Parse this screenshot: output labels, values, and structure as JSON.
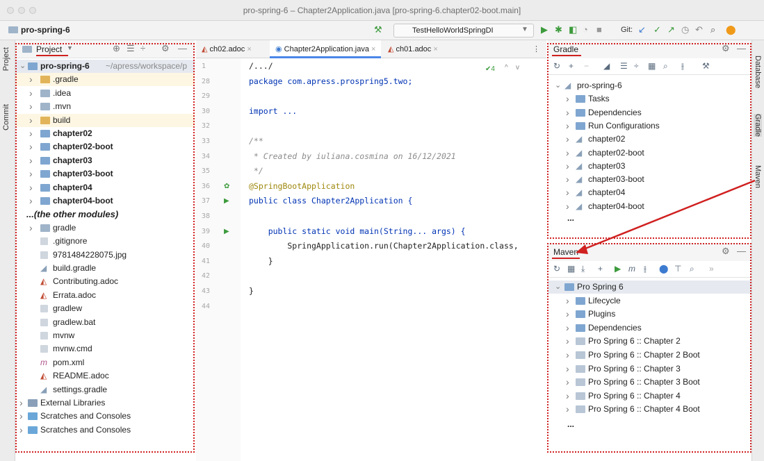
{
  "window": {
    "title": "pro-spring-6 – Chapter2Application.java [pro-spring-6.chapter02-boot.main]"
  },
  "navbar": {
    "project": "pro-spring-6",
    "run_config": "TestHelloWorldSpringDI",
    "git_label": "Git:"
  },
  "left_strip": {
    "project_tab": "Project",
    "commit_tab": "Commit"
  },
  "project_panel": {
    "title": "Project",
    "root": {
      "name": "pro-spring-6",
      "path": "~/apress/workspace/p"
    },
    "items": [
      {
        "label": ".gradle",
        "kind": "folder-orange",
        "expandable": true,
        "bold": false
      },
      {
        "label": ".idea",
        "kind": "folder",
        "expandable": true,
        "bold": false
      },
      {
        "label": ".mvn",
        "kind": "folder",
        "expandable": true,
        "bold": false
      },
      {
        "label": "build",
        "kind": "folder-orange",
        "expandable": true,
        "bold": false
      },
      {
        "label": "chapter02",
        "kind": "module",
        "expandable": true,
        "bold": true
      },
      {
        "label": "chapter02-boot",
        "kind": "module",
        "expandable": true,
        "bold": true
      },
      {
        "label": "chapter03",
        "kind": "module",
        "expandable": true,
        "bold": true
      },
      {
        "label": "chapter03-boot",
        "kind": "module",
        "expandable": true,
        "bold": true
      },
      {
        "label": "chapter04",
        "kind": "module",
        "expandable": true,
        "bold": true
      },
      {
        "label": "chapter04-boot",
        "kind": "module",
        "expandable": true,
        "bold": true
      },
      {
        "label": "...(the other modules)",
        "kind": "note",
        "expandable": false,
        "bold": true
      },
      {
        "label": "gradle",
        "kind": "folder",
        "expandable": true,
        "bold": false
      },
      {
        "label": ".gitignore",
        "kind": "file",
        "expandable": false,
        "bold": false
      },
      {
        "label": "9781484228075.jpg",
        "kind": "file",
        "expandable": false,
        "bold": false
      },
      {
        "label": "build.gradle",
        "kind": "gradle",
        "expandable": false,
        "bold": false
      },
      {
        "label": "Contributing.adoc",
        "kind": "adoc",
        "expandable": false,
        "bold": false
      },
      {
        "label": "Errata.adoc",
        "kind": "adoc",
        "expandable": false,
        "bold": false
      },
      {
        "label": "gradlew",
        "kind": "file",
        "expandable": false,
        "bold": false
      },
      {
        "label": "gradlew.bat",
        "kind": "file",
        "expandable": false,
        "bold": false
      },
      {
        "label": "mvnw",
        "kind": "file",
        "expandable": false,
        "bold": false
      },
      {
        "label": "mvnw.cmd",
        "kind": "file",
        "expandable": false,
        "bold": false
      },
      {
        "label": "pom.xml",
        "kind": "maven",
        "expandable": false,
        "bold": false
      },
      {
        "label": "README.adoc",
        "kind": "adoc",
        "expandable": false,
        "bold": false
      },
      {
        "label": "settings.gradle",
        "kind": "gradle",
        "expandable": false,
        "bold": false
      }
    ],
    "bottom_items": [
      "External Libraries",
      "Scratches and Consoles",
      "Scratches and Consoles"
    ]
  },
  "editor": {
    "tabs": [
      "ch02.adoc",
      "Chapter2Application.java",
      "ch01.adoc"
    ],
    "active_tab": 1,
    "inspection": "4",
    "lines": [
      {
        "num": "1",
        "text": "/.../"
      },
      {
        "num": "28",
        "text": "package com.apress.prospring5.two;"
      },
      {
        "num": "29",
        "text": ""
      },
      {
        "num": "30",
        "text": "import ..."
      },
      {
        "num": "32",
        "text": ""
      },
      {
        "num": "33",
        "text": "/**"
      },
      {
        "num": "34",
        "text": " * Created by iuliana.cosmina on 16/12/2021"
      },
      {
        "num": "35",
        "text": " */"
      },
      {
        "num": "36",
        "text": "@SpringBootApplication"
      },
      {
        "num": "37",
        "text": "public class Chapter2Application {"
      },
      {
        "num": "38",
        "text": ""
      },
      {
        "num": "39",
        "text": "    public static void main(String... args) {"
      },
      {
        "num": "40",
        "text": "        SpringApplication.run(Chapter2Application.class,"
      },
      {
        "num": "41",
        "text": "    }"
      },
      {
        "num": "42",
        "text": ""
      },
      {
        "num": "43",
        "text": "}"
      },
      {
        "num": "44",
        "text": ""
      }
    ]
  },
  "gradle_panel": {
    "title": "Gradle",
    "root": "pro-spring-6",
    "items": [
      "Tasks",
      "Dependencies",
      "Run Configurations",
      "chapter02",
      "chapter02-boot",
      "chapter03",
      "chapter03-boot",
      "chapter04",
      "chapter04-boot"
    ],
    "more": "..."
  },
  "maven_panel": {
    "title": "Maven",
    "root": "Pro Spring 6",
    "items": [
      "Lifecycle",
      "Plugins",
      "Dependencies",
      "Pro Spring 6 :: Chapter 2",
      "Pro Spring 6 :: Chapter 2 Boot",
      "Pro Spring 6 :: Chapter 3",
      "Pro Spring 6 :: Chapter 3 Boot",
      "Pro Spring 6 :: Chapter 4",
      "Pro Spring 6 :: Chapter 4 Boot"
    ],
    "more": "..."
  },
  "right_strip": {
    "database_tab": "Database",
    "gradle_tab": "Gradle",
    "maven_tab": "Maven"
  },
  "colors": {
    "annotation": "#d02020",
    "folder": "#9fb4c9",
    "folder_orange": "#e2b45a",
    "module": "#7fa6d0"
  }
}
